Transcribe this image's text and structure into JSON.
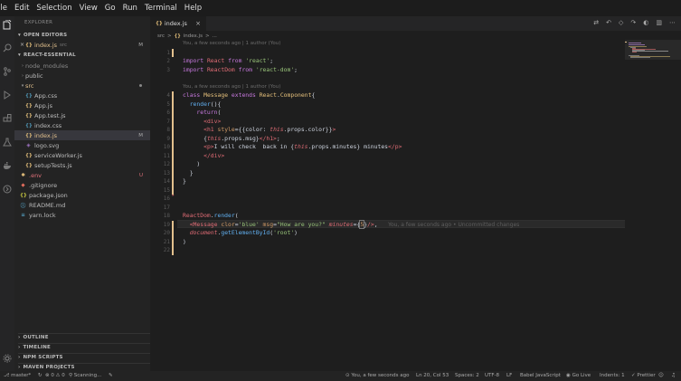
{
  "menu": [
    "ile",
    "Edit",
    "Selection",
    "View",
    "Go",
    "Run",
    "Terminal",
    "Help"
  ],
  "activity_icons": [
    "files-icon",
    "search-icon",
    "source-control-icon",
    "run-debug-icon",
    "extensions-icon",
    "flask-icon",
    "docker-icon",
    "remote-icon",
    "settings-gear-icon"
  ],
  "sidebar": {
    "title": "EXPLORER",
    "open_editors": {
      "header": "OPEN EDITORS",
      "items": [
        {
          "icon": "{}",
          "name": "index.js",
          "desc": "src",
          "status": "M"
        }
      ]
    },
    "project": {
      "header": "REACT-ESSENTIAL",
      "items": [
        {
          "type": "folder",
          "name": "node_modules",
          "collapsed": true
        },
        {
          "type": "folder",
          "name": "public",
          "collapsed": true
        },
        {
          "type": "folder",
          "name": "src",
          "collapsed": false,
          "dot": true
        },
        {
          "type": "file",
          "icon": "{}",
          "name": "App.css",
          "level": 1
        },
        {
          "type": "file",
          "icon": "{}",
          "name": "App.js",
          "level": 1
        },
        {
          "type": "file",
          "icon": "{}",
          "name": "App.test.js",
          "level": 1
        },
        {
          "type": "file",
          "icon": "{}",
          "name": "index.css",
          "level": 1
        },
        {
          "type": "file",
          "icon": "{}",
          "name": "index.js",
          "level": 1,
          "status": "M",
          "selected": true
        },
        {
          "type": "file",
          "icon": "◈",
          "name": "logo.svg",
          "level": 1
        },
        {
          "type": "file",
          "icon": "{}",
          "name": "serviceWorker.js",
          "level": 1
        },
        {
          "type": "file",
          "icon": "{}",
          "name": "setupTests.js",
          "level": 1
        },
        {
          "type": "file",
          "icon": "✱",
          "name": ".env",
          "level": 0,
          "status": "U"
        },
        {
          "type": "file",
          "icon": "◆",
          "name": ".gitignore",
          "level": 0
        },
        {
          "type": "file",
          "icon": "{}",
          "name": "package.json",
          "level": 0
        },
        {
          "type": "file",
          "icon": "ⓘ",
          "name": "README.md",
          "level": 0
        },
        {
          "type": "file",
          "icon": "≡",
          "name": "yarn.lock",
          "level": 0
        }
      ]
    },
    "bottom_sections": [
      "OUTLINE",
      "TIMELINE",
      "NPM SCRIPTS",
      "MAVEN PROJECTS"
    ]
  },
  "tab": {
    "icon": "{}",
    "label": "index.js",
    "close": "×"
  },
  "breadcrumb": {
    "folder": "src",
    "sep": ">",
    "icon": "{}",
    "file": "index.js",
    "more": "..."
  },
  "editor": {
    "codelens": [
      "You, a few seconds ago | 1 author (You)",
      "You, a few seconds ago | 1 author (You)"
    ],
    "line_numbers": [
      "1",
      "2",
      "3",
      "4",
      "5",
      "6",
      "7",
      "8",
      "9",
      "10",
      "11",
      "12",
      "13",
      "14",
      "15",
      "16",
      "17",
      "18",
      "19",
      "20",
      "21",
      "22"
    ],
    "ghost_blame": "You, a few seconds ago • Uncommitted changes"
  },
  "status": {
    "branch": "master*",
    "errors": "⊗ 0 ⚠ 0",
    "scanning": "Scanning...",
    "blame": "You, a few seconds ago",
    "position": "Ln 20, Col 53",
    "spaces": "Spaces: 2",
    "encoding": "UTF-8",
    "eol": "LF",
    "language": "Babel JavaScript",
    "golive": "Go Live",
    "indents": "Indents: 1",
    "prettier": "Prettier"
  },
  "colors": {
    "accent_modified": "#e2c08d",
    "untracked": "#e0707a",
    "editor_bg": "#1e1e1e"
  }
}
